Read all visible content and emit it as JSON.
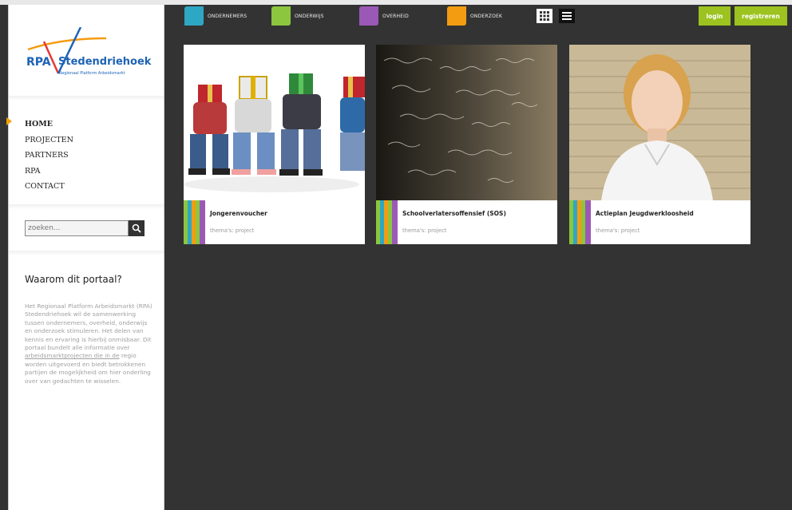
{
  "logo": {
    "rpa": "RPA",
    "name": "Stedendriehoek",
    "tagline": "Regionaal Platform Arbeidsmarkt"
  },
  "nav": {
    "items": [
      "HOME",
      "PROJECTEN",
      "PARTNERS",
      "RPA",
      "CONTACT"
    ]
  },
  "search": {
    "placeholder": "zoeken..."
  },
  "why": {
    "title": "Waarom dit portaal?",
    "text_before_link": "Het Regionaal Platform Arbeidsmarkt (RPA) Stedendriehoek wil de samenwerking tussen ondernemers, overheid, onderwijs en onderzoek stimuleren. Het delen van kennis en ervaring is hierbij onmisbaar. Dit portaal bundelt alle informatie over ",
    "link": "arbeidsmarktprojecten die in de",
    "text_after_link": " regio worden uitgevoerd en biedt betrokkenen partijen de mogelijkheid om hier onderling over van gedachten te wisselen."
  },
  "topnav": {
    "categories": [
      {
        "label": "ONDERNEMERS",
        "color": "#2ea7c4"
      },
      {
        "label": "ONDERWIJS",
        "color": "#8cc63f"
      },
      {
        "label": "OVERHEID",
        "color": "#9b59b6"
      },
      {
        "label": "ONDERZOEK",
        "color": "#f39c12"
      }
    ],
    "login": "login",
    "register": "registreren"
  },
  "cards": [
    {
      "title": "Jongerenvoucher",
      "subtitle": "thema's: project"
    },
    {
      "title": "Schoolverlatersoffensief (SOS)",
      "subtitle": "thema's: project"
    },
    {
      "title": "Actieplan Jeugdwerkloosheid",
      "subtitle": "thema's: project"
    }
  ],
  "colors": {
    "background": "#333333",
    "accent_green": "#9cc31f",
    "nav_arrow": "#f0a000",
    "logo_blue": "#1e63b5"
  }
}
